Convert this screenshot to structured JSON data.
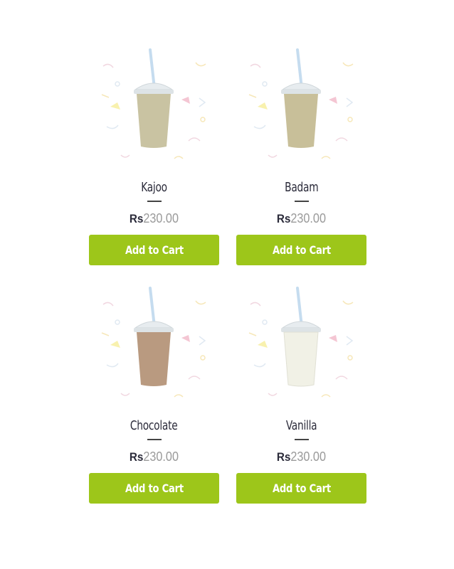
{
  "products": [
    {
      "name": "Kajoo",
      "currency": "Rs",
      "price": "230.00",
      "button": "Add to Cart",
      "drink_color": "#c9c3a2"
    },
    {
      "name": "Badam",
      "currency": "Rs",
      "price": "230.00",
      "button": "Add to Cart",
      "drink_color": "#c8bf99"
    },
    {
      "name": "Chocolate",
      "currency": "Rs",
      "price": "230.00",
      "button": "Add to Cart",
      "drink_color": "#b99a80"
    },
    {
      "name": "Vanilla",
      "currency": "Rs",
      "price": "230.00",
      "button": "Add to Cart",
      "drink_color": "#f1f1e6"
    }
  ],
  "colors": {
    "accent": "#9dc61a"
  }
}
